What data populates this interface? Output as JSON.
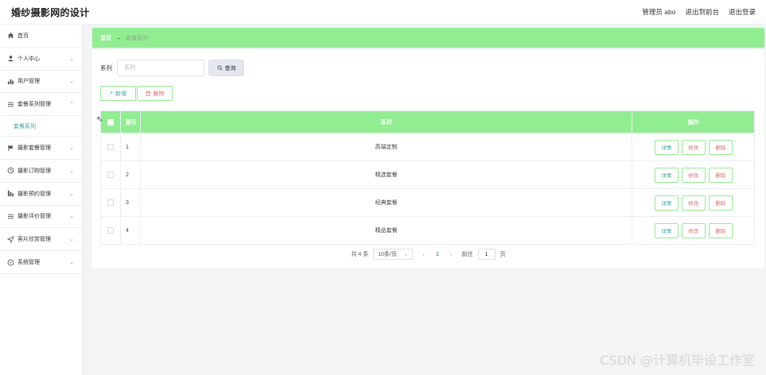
{
  "header": {
    "title": "婚纱摄影网的设计",
    "admin_label": "管理员 abo",
    "front_label": "退出到前台",
    "logout_label": "退出登录"
  },
  "sidebar": {
    "items": [
      {
        "label": "首页",
        "icon": "home-icon"
      },
      {
        "label": "个人中心",
        "icon": "user-icon"
      },
      {
        "label": "用户管理",
        "icon": "chart-icon"
      },
      {
        "label": "套餐系列管理",
        "icon": "list-icon"
      },
      {
        "label": "套餐系列",
        "icon": ""
      },
      {
        "label": "摄影套餐管理",
        "icon": "flag-icon"
      },
      {
        "label": "摄影订购管理",
        "icon": "clock-icon"
      },
      {
        "label": "摄影预约管理",
        "icon": "bar-icon"
      },
      {
        "label": "摄影评价管理",
        "icon": "list-icon"
      },
      {
        "label": "客片欣赏管理",
        "icon": "send-icon"
      },
      {
        "label": "系统管理",
        "icon": "compass-icon"
      }
    ]
  },
  "breadcrumb": {
    "home": "首页",
    "separator": "→",
    "current": "套餐系列"
  },
  "search": {
    "label": "系列",
    "placeholder": "系列",
    "button": "查询"
  },
  "actions": {
    "add": "新增",
    "delete": "删除"
  },
  "table": {
    "headers": {
      "index": "索引",
      "name": "系列",
      "ops": "操作"
    },
    "rows": [
      {
        "index": "1",
        "name": "高端定制"
      },
      {
        "index": "2",
        "name": "精选套餐"
      },
      {
        "index": "3",
        "name": "经典套餐"
      },
      {
        "index": "4",
        "name": "精品套餐"
      }
    ],
    "op_labels": {
      "detail": "详情",
      "edit": "修改",
      "delete": "删除"
    }
  },
  "pagination": {
    "total": "共 4 条",
    "page_size": "10条/页",
    "current_page": "1",
    "goto_prefix": "前往",
    "goto_value": "1",
    "goto_suffix": "页"
  },
  "watermark": "CSDN @计算机毕设工作室",
  "colors": {
    "accent": "#90ee90",
    "link": "#3aa89a",
    "danger": "#e06c6c"
  }
}
